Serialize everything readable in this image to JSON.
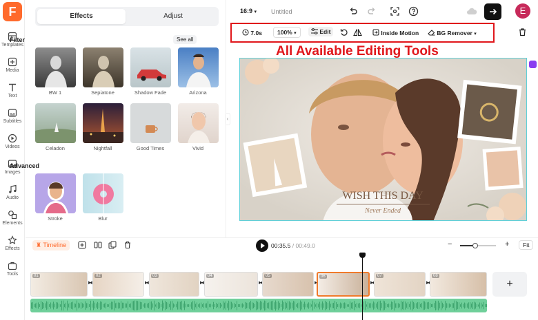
{
  "app": {
    "logo_letter": "F",
    "title": "Untitled",
    "aspect_ratio": "16:9",
    "avatar_letter": "E",
    "accent": "#ff6a2c"
  },
  "rail": [
    {
      "label": "Templates"
    },
    {
      "label": "Media"
    },
    {
      "label": "Text"
    },
    {
      "label": "Subtitles"
    },
    {
      "label": "Videos"
    },
    {
      "label": "Images"
    },
    {
      "label": "Audio"
    },
    {
      "label": "Elements"
    },
    {
      "label": "Effects"
    },
    {
      "label": "Tools"
    }
  ],
  "panel": {
    "tabs": [
      "Effects",
      "Adjust"
    ],
    "filter_title": "Filter",
    "see_all": "See all",
    "filters": [
      "BW 1",
      "Sepiatone",
      "Shadow Fade",
      "Arizona",
      "Celadon",
      "Nightfall",
      "Good Times",
      "Vivid"
    ],
    "advanced_title": "Advanced",
    "advanced": [
      "Stroke",
      "Blur"
    ]
  },
  "toolbar": {
    "duration": "7.0s",
    "zoom": "100%",
    "edit": "Edit",
    "inside_motion": "Inside Motion",
    "bg_remover": "BG Remover"
  },
  "annotation": {
    "callout": "All Available Editing Tools",
    "color": "#e0161b"
  },
  "canvas": {
    "headline": "WISH THIS DAY",
    "subline": "Never Ended"
  },
  "timeline": {
    "label": "Timeline",
    "current_time": "00:35.5",
    "total_time": "/ 00:49.0",
    "fit": "Fit",
    "clip_numbers": [
      "01",
      "02",
      "03",
      "04",
      "05",
      "06",
      "07",
      "08"
    ]
  }
}
